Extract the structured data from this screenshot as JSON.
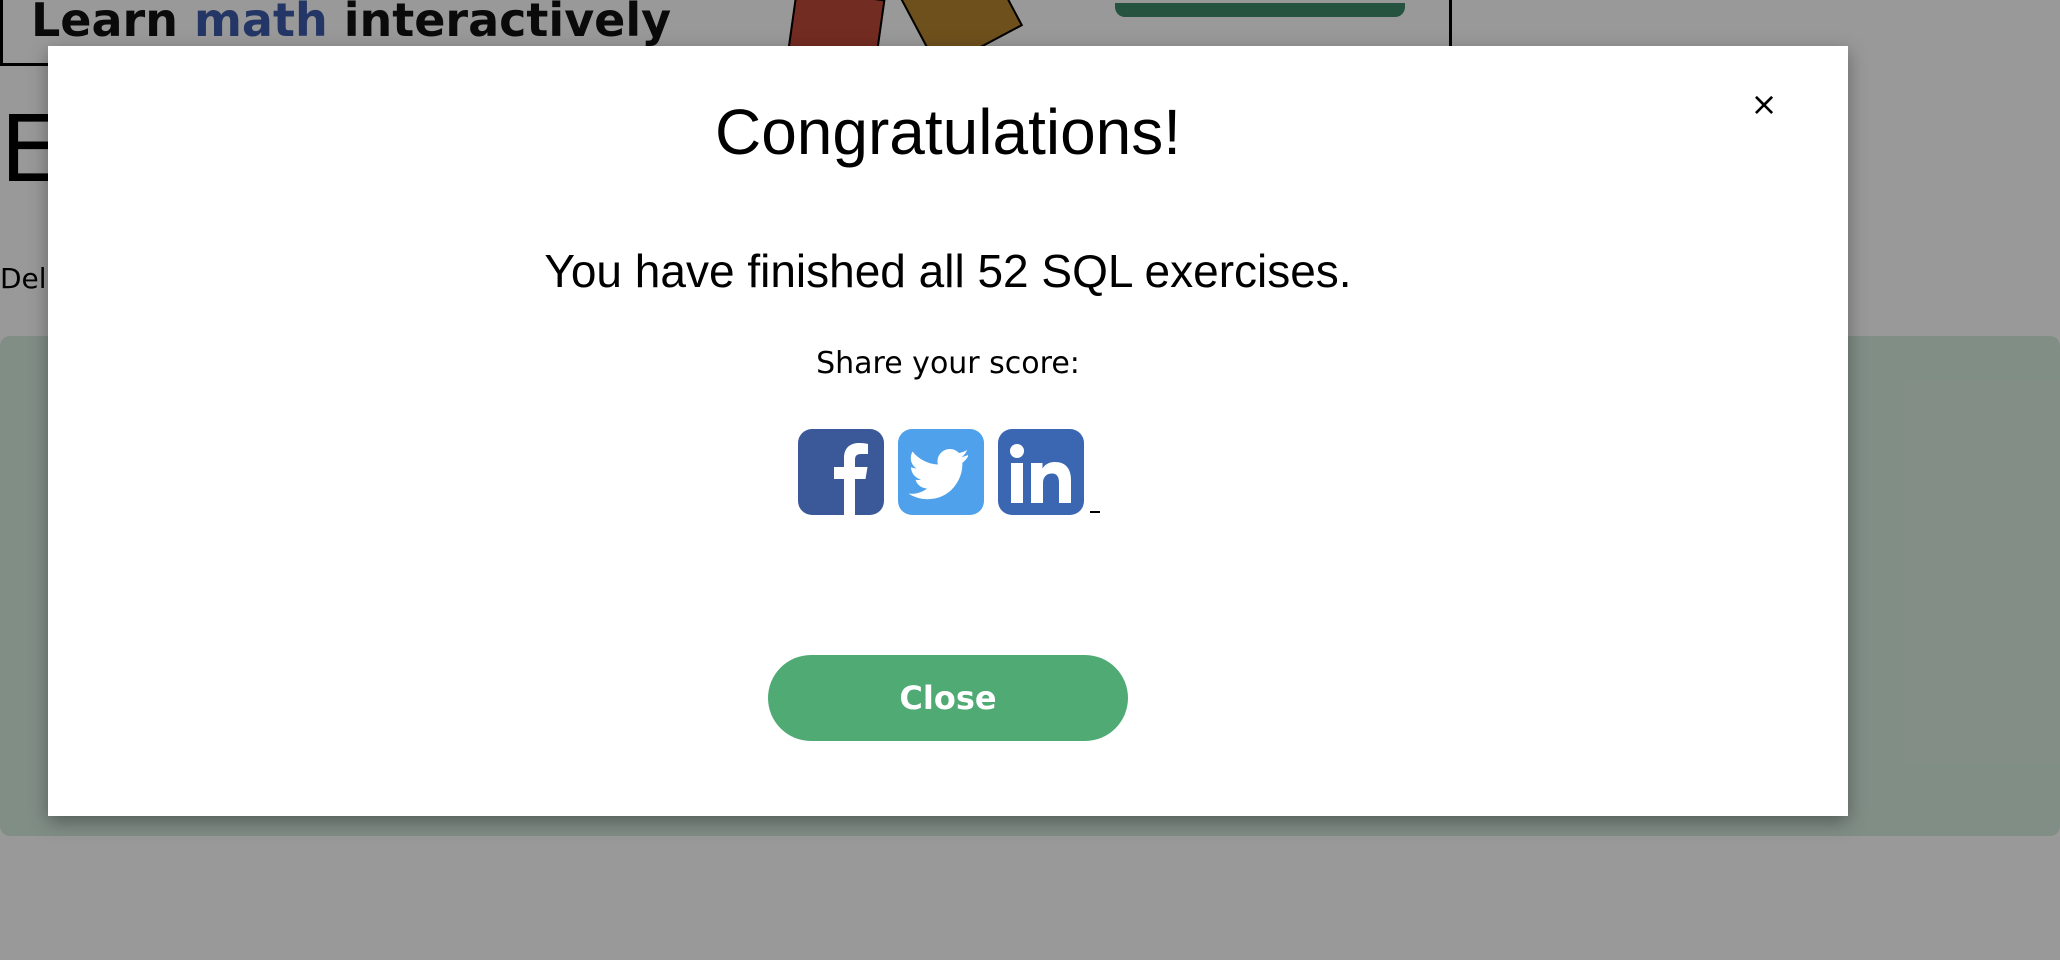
{
  "background": {
    "ad": {
      "text_before": "Learn ",
      "text_accent": "math",
      "text_after": " interactively",
      "accent_color": "#3d5aa8",
      "button_color": "#3e8a6a"
    },
    "heading_fragment": "E",
    "subtext_fragment": "Del",
    "panel_color": "#d8ede0"
  },
  "modal": {
    "title": "Congratulations!",
    "message": "You have finished all 52 SQL exercises.",
    "share_label": "Share your score:",
    "close_x": "×",
    "close_button_label": "Close",
    "close_button_color": "#4faa74",
    "share_buttons": [
      {
        "network": "Facebook",
        "icon": "facebook-icon",
        "color": "#3b5998"
      },
      {
        "network": "Twitter",
        "icon": "twitter-icon",
        "color": "#4ea1ea"
      },
      {
        "network": "LinkedIn",
        "icon": "linkedin-icon",
        "color": "#3a66b2"
      }
    ]
  }
}
